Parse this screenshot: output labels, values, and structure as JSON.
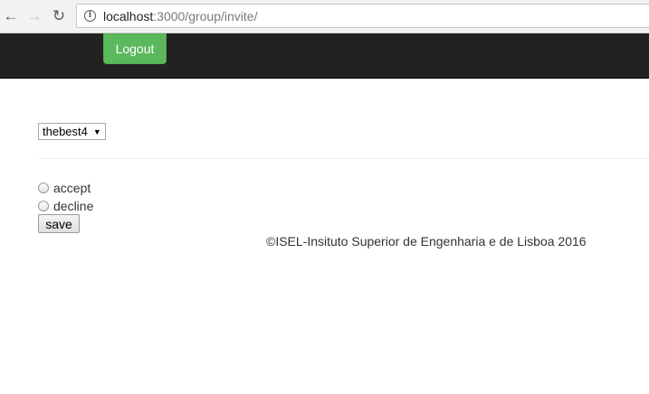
{
  "browser": {
    "url_host": "localhost",
    "url_path": ":3000/group/invite/"
  },
  "navbar": {
    "logout_label": "Logout"
  },
  "form": {
    "group_select_value": "thebest4",
    "accept_label": "accept",
    "decline_label": "decline",
    "save_label": "save"
  },
  "footer": {
    "text": "©ISEL-Insituto Superior de Engenharia e de Lisboa 2016"
  },
  "colors": {
    "navbar_bg": "#222222",
    "logout_bg": "#5cb85c"
  }
}
